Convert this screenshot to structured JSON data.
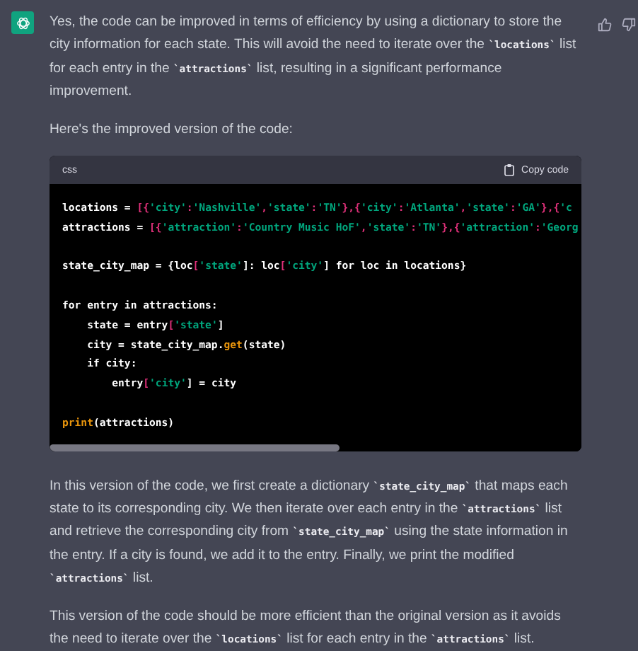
{
  "message": {
    "paragraphs_before": [
      "Yes, the code can be improved in terms of efficiency by using a dictionary to store the city information for each state. This will avoid the need to iterate over the **`locations`** list for each entry in the **`attractions`** list, resulting in a significant performance improvement.",
      "Here's the improved version of the code:"
    ],
    "code_block": {
      "language": "css",
      "copy_label": "Copy code",
      "lines": [
        {
          "kind": "code",
          "tokens": [
            {
              "kind": "plain",
              "t": "locations = "
            },
            {
              "kind": "punct",
              "t": "[{"
            },
            {
              "kind": "string",
              "t": "'city'"
            },
            {
              "kind": "punct",
              "t": ":"
            },
            {
              "kind": "string",
              "t": "'Nashville'"
            },
            {
              "kind": "punct",
              "t": ","
            },
            {
              "kind": "string",
              "t": "'state'"
            },
            {
              "kind": "punct",
              "t": ":"
            },
            {
              "kind": "string",
              "t": "'TN'"
            },
            {
              "kind": "punct",
              "t": "},{"
            },
            {
              "kind": "string",
              "t": "'city'"
            },
            {
              "kind": "punct",
              "t": ":"
            },
            {
              "kind": "string",
              "t": "'Atlanta'"
            },
            {
              "kind": "punct",
              "t": ","
            },
            {
              "kind": "string",
              "t": "'state'"
            },
            {
              "kind": "punct",
              "t": ":"
            },
            {
              "kind": "string",
              "t": "'GA'"
            },
            {
              "kind": "punct",
              "t": "},{"
            },
            {
              "kind": "string",
              "t": "'c"
            }
          ]
        },
        {
          "kind": "code",
          "tokens": [
            {
              "kind": "plain",
              "t": "attractions = "
            },
            {
              "kind": "punct",
              "t": "[{"
            },
            {
              "kind": "string",
              "t": "'attraction'"
            },
            {
              "kind": "punct",
              "t": ":"
            },
            {
              "kind": "string",
              "t": "'Country Music HoF'"
            },
            {
              "kind": "punct",
              "t": ","
            },
            {
              "kind": "string",
              "t": "'state'"
            },
            {
              "kind": "punct",
              "t": ":"
            },
            {
              "kind": "string",
              "t": "'TN'"
            },
            {
              "kind": "punct",
              "t": "},{"
            },
            {
              "kind": "string",
              "t": "'attraction'"
            },
            {
              "kind": "punct",
              "t": ":"
            },
            {
              "kind": "string",
              "t": "'Georg"
            }
          ]
        },
        {
          "kind": "blank"
        },
        {
          "kind": "code",
          "tokens": [
            {
              "kind": "plain",
              "t": "state_city_map = {loc"
            },
            {
              "kind": "punct",
              "t": "["
            },
            {
              "kind": "string",
              "t": "'state'"
            },
            {
              "kind": "plain",
              "t": "]: loc"
            },
            {
              "kind": "punct",
              "t": "["
            },
            {
              "kind": "string",
              "t": "'city'"
            },
            {
              "kind": "plain",
              "t": "] for loc in locations}"
            }
          ]
        },
        {
          "kind": "blank"
        },
        {
          "kind": "code",
          "tokens": [
            {
              "kind": "plain",
              "t": "for entry in attractions:"
            }
          ]
        },
        {
          "kind": "code",
          "tokens": [
            {
              "kind": "plain",
              "t": "    state = entry"
            },
            {
              "kind": "punct",
              "t": "["
            },
            {
              "kind": "string",
              "t": "'state'"
            },
            {
              "kind": "plain",
              "t": "]"
            }
          ]
        },
        {
          "kind": "code",
          "tokens": [
            {
              "kind": "plain",
              "t": "    city = state_city_map."
            },
            {
              "kind": "func",
              "t": "get"
            },
            {
              "kind": "plain",
              "t": "(state)"
            }
          ]
        },
        {
          "kind": "code",
          "tokens": [
            {
              "kind": "plain",
              "t": "    if city:"
            }
          ]
        },
        {
          "kind": "code",
          "tokens": [
            {
              "kind": "plain",
              "t": "        entry"
            },
            {
              "kind": "punct",
              "t": "["
            },
            {
              "kind": "string",
              "t": "'city'"
            },
            {
              "kind": "plain",
              "t": "] = city"
            }
          ]
        },
        {
          "kind": "blank"
        },
        {
          "kind": "code",
          "tokens": [
            {
              "kind": "func",
              "t": "print"
            },
            {
              "kind": "plain",
              "t": "(attractions)"
            }
          ]
        }
      ]
    },
    "paragraphs_after": [
      "In this version of the code, we first create a dictionary **`state_city_map`** that maps each state to its corresponding city. We then iterate over each entry in the **`attractions`** list and retrieve the corresponding city from **`state_city_map`** using the state information in the entry. If a city is found, we add it to the entry. Finally, we print the modified **`attractions`** list.",
      "This version of the code should be more efficient than the original version as it avoids the need to iterate over the **`locations`** list for each entry in the **`attractions`** list."
    ]
  }
}
